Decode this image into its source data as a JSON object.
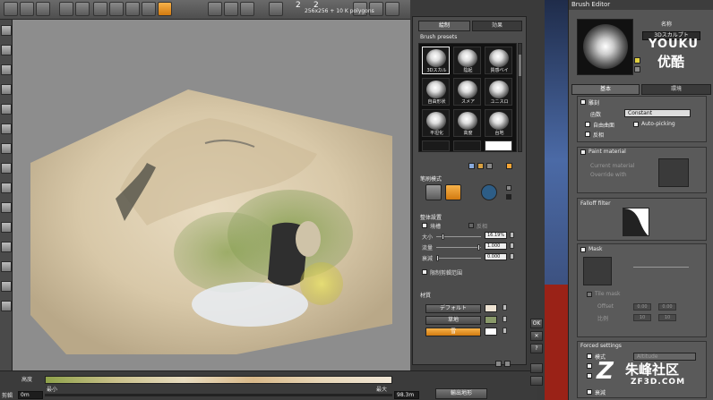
{
  "toolbar": {
    "canvas_info": "256x256 + 10 K polygons",
    "num1": "2",
    "num2": "2"
  },
  "panel": {
    "tab_paint": "絵制",
    "tab_effect": "効果",
    "brush_presets_title": "Brush presets",
    "presets": [
      "3Dスカル",
      "陰起",
      "質感ベイ",
      "自由形状",
      "スメア",
      "ユニスロ",
      "平坦化",
      "高度",
      "台地",
      "",
      "",
      ""
    ],
    "stroke_mode_title": "笔刷模式",
    "overall_title": "整体設置",
    "symmetry_label": "境槽",
    "rotate_label": "反相",
    "size_label": "大小",
    "size_value": "16.19%",
    "flow_label": "流量",
    "flow_value": "1.000",
    "falloff_label": "衰減",
    "falloff_value": "0.000",
    "limit_label": "限制剪輯范围",
    "material_title": "材質",
    "materials": [
      {
        "label": "デフォルト",
        "color": "#eee3d3",
        "active": false
      },
      {
        "label": "草地",
        "color": "#8a9a6a",
        "active": false
      },
      {
        "label": "雪",
        "color": "#ffffff",
        "active": true
      }
    ]
  },
  "side_buttons": [
    "OK",
    "✕",
    "?"
  ],
  "bottom": {
    "height_label": "高度",
    "min_label": "最小",
    "max_label": "最大",
    "trim_label": "剪輯",
    "value_left": "0m",
    "value_right": "98.3m",
    "output_button": "輸出地形"
  },
  "editor": {
    "title": "Brush Editor",
    "name_label": "名称",
    "name_value": "3Dスカルプト",
    "tab_basic": "基本",
    "tab_env": "環境",
    "carve_label": "雕刻",
    "func_label": "函数",
    "func_value": "Constant",
    "free_curve_label": "自由曲面",
    "invert_label": "反相",
    "autopick_label": "Auto-picking",
    "paint_material_label": "Paint material",
    "current_material": "Current material",
    "override_with": "Override with",
    "falloff_filter_label": "Falloff filter",
    "mask_label": "Mask",
    "tile_mask": "Tile mask",
    "offset_label": "Offset",
    "offset_v1": "0.00",
    "offset_v2": "0.00",
    "scale_label": "比例",
    "scale_v1": "10",
    "scale_v2": "10",
    "forced_label": "Forced settings",
    "forced_item1": "模式",
    "forced_value1": "Altitude",
    "forced_item2": "衰減"
  },
  "watermarks": {
    "youku": "YOUKU",
    "youku_cn": "优酷",
    "zf3d_cn": "朱峰社区",
    "zf3d_url": "ZF3D.COM"
  }
}
